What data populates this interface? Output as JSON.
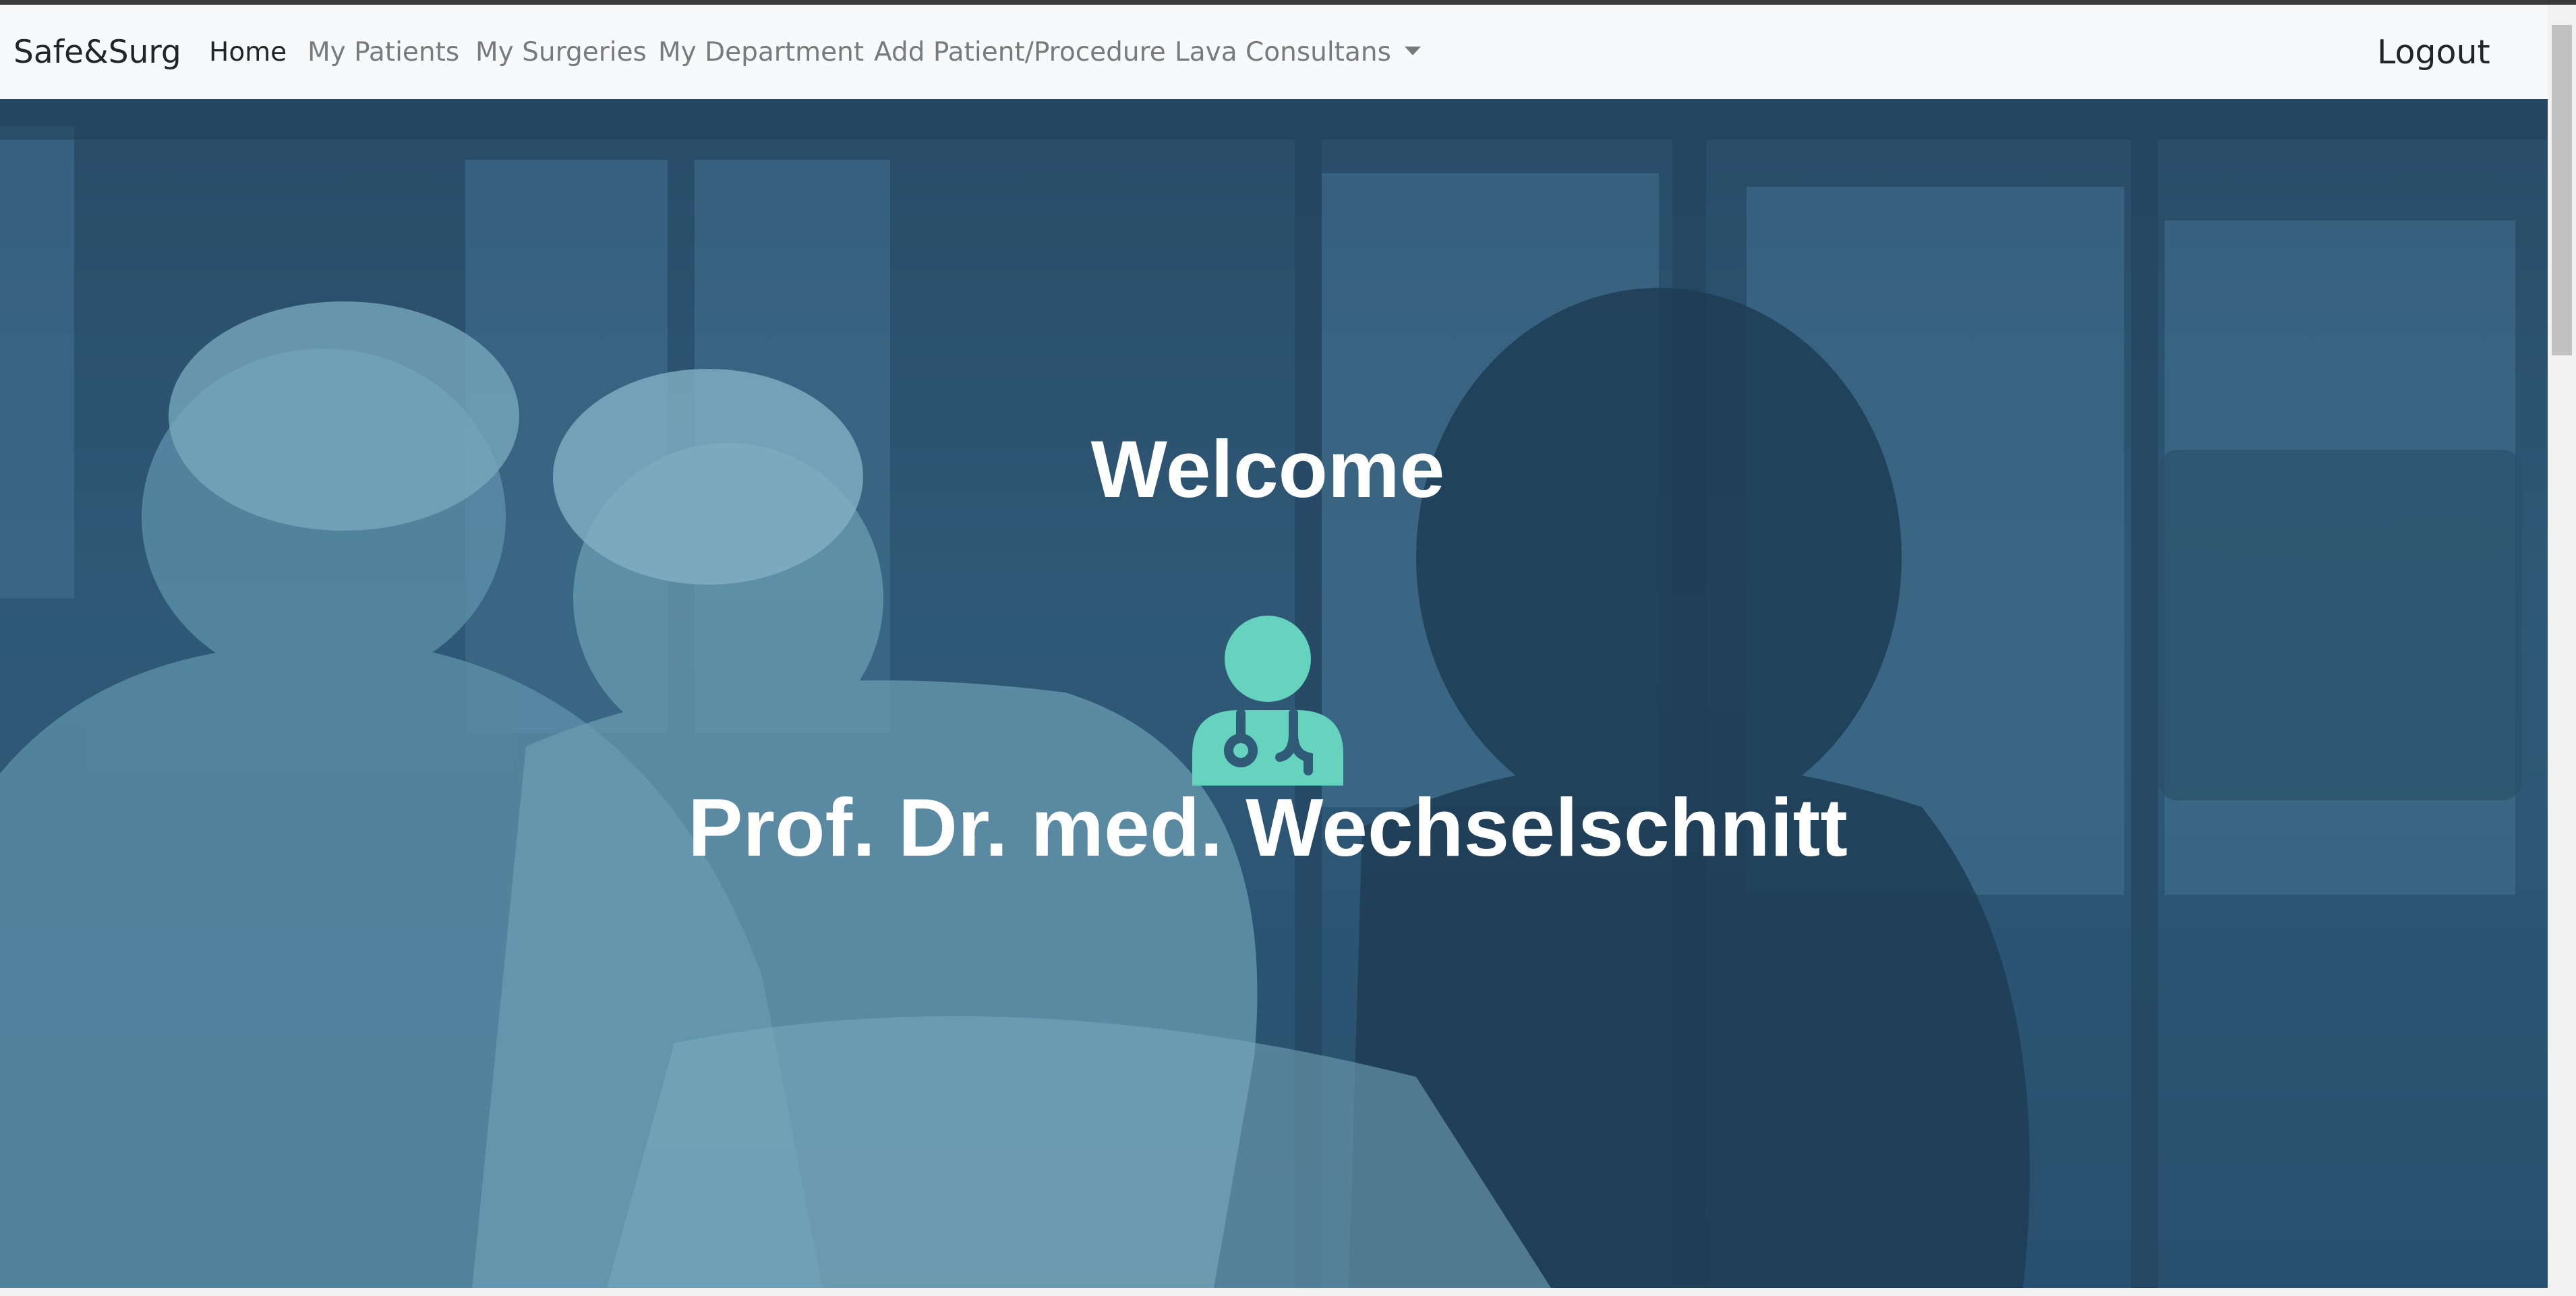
{
  "navbar": {
    "brand": "Safe&Surg",
    "items": [
      {
        "label": "Home",
        "active": true
      },
      {
        "label": "My Patients",
        "active": false
      },
      {
        "label": "My Surgeries",
        "active": false
      },
      {
        "label": "My Department",
        "active": false
      },
      {
        "label": "Add Patient/Procedure",
        "active": false
      },
      {
        "label": "Lava Consultans",
        "active": false,
        "dropdown": true
      }
    ],
    "logout_label": "Logout"
  },
  "hero": {
    "welcome": "Welcome",
    "icon": "user-doctor-icon",
    "user_name": "Prof. Dr. med. Wechselschnitt"
  },
  "colors": {
    "hero_overlay": "#2c4f6b",
    "icon_accent": "#66d3be",
    "navbar_bg": "#f8f9fa",
    "nav_text_muted": "#7a7a7a",
    "nav_text_active": "#212529"
  }
}
